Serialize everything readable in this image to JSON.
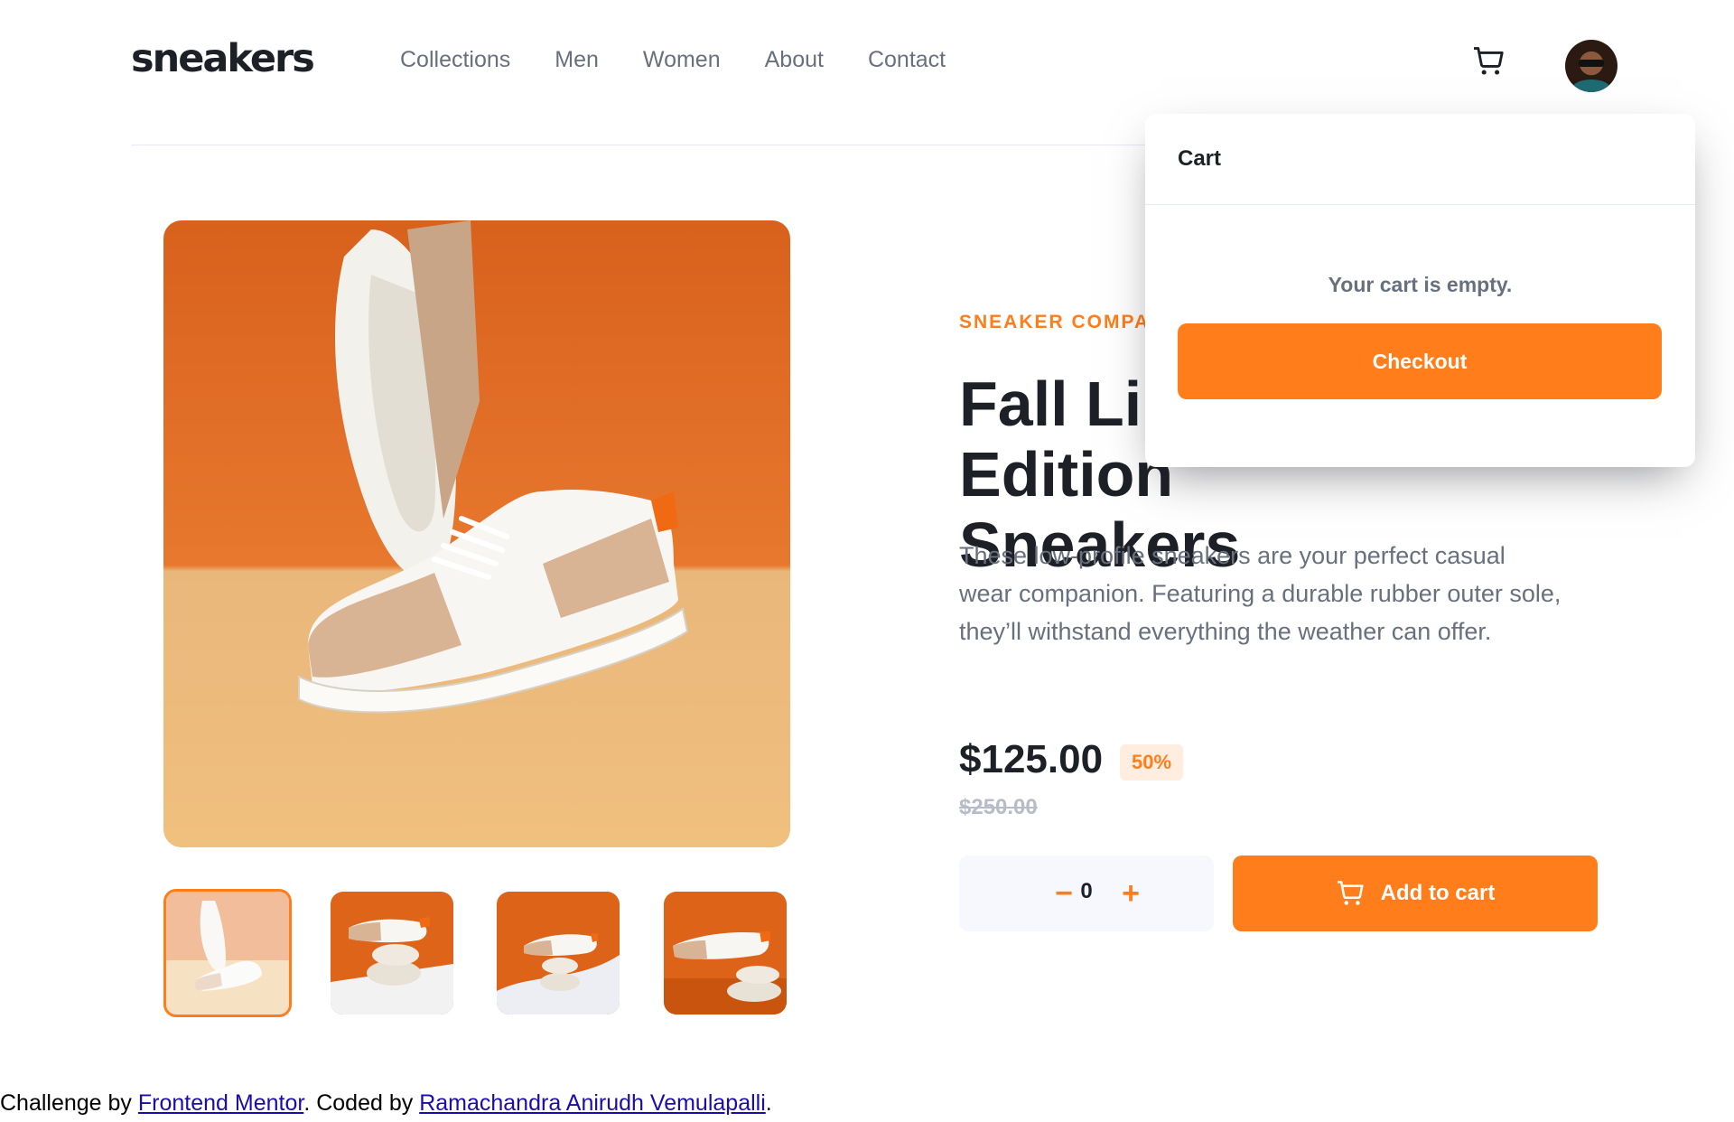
{
  "header": {
    "logo": "sneakers",
    "nav": [
      "Collections",
      "Men",
      "Women",
      "About",
      "Contact"
    ],
    "cart_icon": "cart-icon",
    "avatar_icon": "avatar-icon"
  },
  "gallery": {
    "main_image": "sneaker-product-image",
    "thumbnails": [
      "thumbnail-1",
      "thumbnail-2",
      "thumbnail-3",
      "thumbnail-4"
    ],
    "active_thumbnail": 1
  },
  "product": {
    "company": "SNEAKER COMPANY",
    "title_line1": "Fall Limited Edition",
    "title_line2": "Sneakers",
    "description": "These low-profile sneakers are your perfect casual wear companion. Featuring a durable rubber outer sole, they’ll withstand everything the weather can offer.",
    "price": "$125.00",
    "discount": "50%",
    "old_price": "$250.00",
    "quantity": "0",
    "minus_label": "−",
    "plus_label": "+",
    "add_to_cart": "Add to cart"
  },
  "cart": {
    "title": "Cart",
    "empty_message": "Your cart is empty.",
    "checkout_label": "Checkout"
  },
  "footer": {
    "prefix": "Challenge by ",
    "link1": "Frontend Mentor",
    "middle": ". Coded by ",
    "link2": "Ramachandra Anirudh Vemulapalli",
    "suffix": "."
  },
  "colors": {
    "accent": "#ff7d1a",
    "accent_light": "#ffede0",
    "text_dark": "#1d2026",
    "text_muted": "#69707d",
    "link": "#1a0dab"
  }
}
